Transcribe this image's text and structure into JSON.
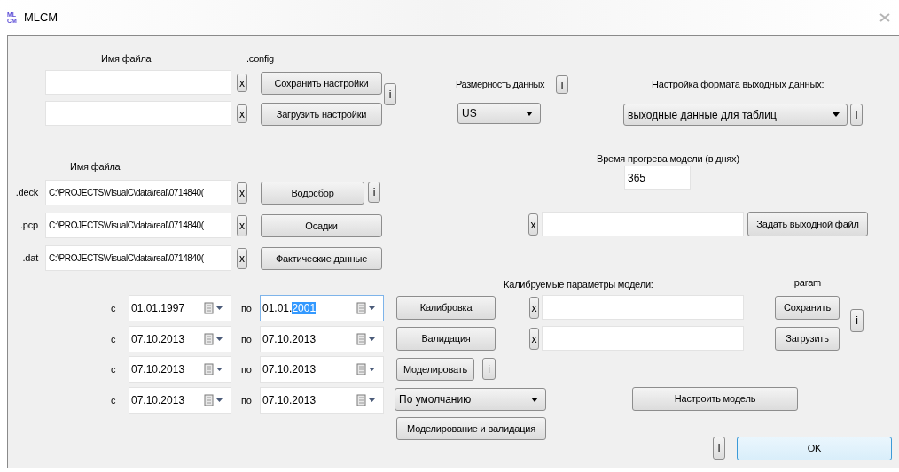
{
  "window": {
    "title": "MLCM",
    "logo": [
      "ML",
      "CM"
    ]
  },
  "config": {
    "filename_label": "Имя файла",
    "ext_label": ".config",
    "info": "i",
    "rows": [
      {
        "clear": "x",
        "button": "Сохранить настройки"
      },
      {
        "clear": "x",
        "button": "Загрузить настройки"
      }
    ]
  },
  "dimension": {
    "label": "Размерность данных",
    "info": "i",
    "value": "US"
  },
  "output_format": {
    "label": "Настройка формата выходных данных:",
    "value": "выходные данные для таблиц",
    "info": "i"
  },
  "warmup": {
    "label": "Время прогрева модели (в днях)",
    "value": "365"
  },
  "output_file": {
    "clear": "x",
    "button": "Задать выходной файл"
  },
  "inputs": {
    "filename_label": "Имя файла",
    "rows": [
      {
        "ext": ".deck",
        "value": "C:\\PROJECTS\\VisualC\\data\\real\\0714840(",
        "clear": "x",
        "button": "Водосбор",
        "info": "i"
      },
      {
        "ext": ".pcp",
        "value": "C:\\PROJECTS\\VisualC\\data\\real\\0714840(",
        "clear": "x",
        "button": "Осадки"
      },
      {
        "ext": ".dat",
        "value": "C:\\PROJECTS\\VisualC\\data\\real\\0714840(",
        "clear": "x",
        "button": "Фактические данные"
      }
    ]
  },
  "periods": [
    {
      "from_label": "с",
      "from": {
        "value": "01.01.1997",
        "focused": false
      },
      "to_label": "по",
      "to": {
        "value": "01.01.",
        "selection": "2001",
        "focused": true
      }
    },
    {
      "from_label": "с",
      "from": {
        "value": "07.10.2013",
        "focused": false
      },
      "to_label": "по",
      "to": {
        "value": "07.10.2013",
        "focused": false
      }
    },
    {
      "from_label": "с",
      "from": {
        "value": "07.10.2013",
        "focused": false
      },
      "to_label": "по",
      "to": {
        "value": "07.10.2013",
        "focused": false
      }
    },
    {
      "from_label": "с",
      "from": {
        "value": "07.10.2013",
        "focused": false
      },
      "to_label": "по",
      "to": {
        "value": "07.10.2013",
        "focused": false
      }
    }
  ],
  "actions": {
    "calibrate": "Калибровка",
    "validate": "Валидация",
    "simulate": "Моделировать",
    "simulate_info": "i",
    "mode": "По умолчанию",
    "simulate_validate": "Моделирование и валидация"
  },
  "calibration": {
    "label": "Калибруемые параметры модели:",
    "ext_label": ".param",
    "rows": [
      {
        "clear": "x",
        "button": "Сохранить"
      },
      {
        "clear": "x",
        "button": "Загрузить"
      }
    ],
    "info": "i"
  },
  "tune_button": "Настроить модель",
  "footer": {
    "info": "i",
    "ok": "OK",
    "ok_default": true
  }
}
